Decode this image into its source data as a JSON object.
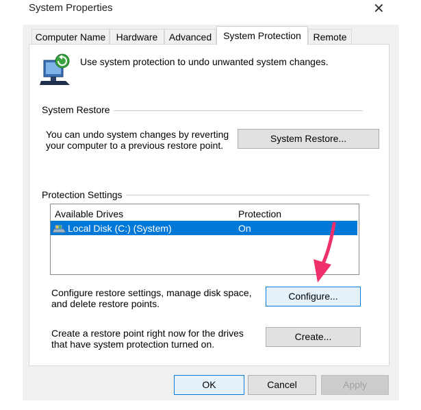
{
  "window": {
    "title": "System Properties",
    "close_glyph": "✕"
  },
  "tabs": [
    {
      "label": "Computer Name",
      "active": false
    },
    {
      "label": "Hardware",
      "active": false
    },
    {
      "label": "Advanced",
      "active": false
    },
    {
      "label": "System Protection",
      "active": true
    },
    {
      "label": "Remote",
      "active": false
    }
  ],
  "intro": {
    "icon": "system-protection-icon",
    "text": "Use system protection to undo unwanted system changes."
  },
  "system_restore": {
    "group_label": "System Restore",
    "description": [
      "You can undo system changes by reverting",
      "your computer to a previous restore point."
    ],
    "button_label": "System Restore..."
  },
  "protection_settings": {
    "group_label": "Protection Settings",
    "columns": [
      "Available Drives",
      "Protection"
    ],
    "drives": [
      {
        "name": "Local Disk (C:) (System)",
        "protection": "On",
        "icon": "drive-icon",
        "selected": true
      }
    ],
    "configure_text": [
      "Configure restore settings, manage disk space,",
      "and delete restore points."
    ],
    "configure_button": "Configure...",
    "create_text": [
      "Create a restore point right now for the drives",
      "that have system protection turned on."
    ],
    "create_button": "Create..."
  },
  "footer": {
    "ok": "OK",
    "cancel": "Cancel",
    "apply": "Apply"
  },
  "colors": {
    "selection": "#0078d7",
    "annotation_arrow": "#f0306a"
  }
}
